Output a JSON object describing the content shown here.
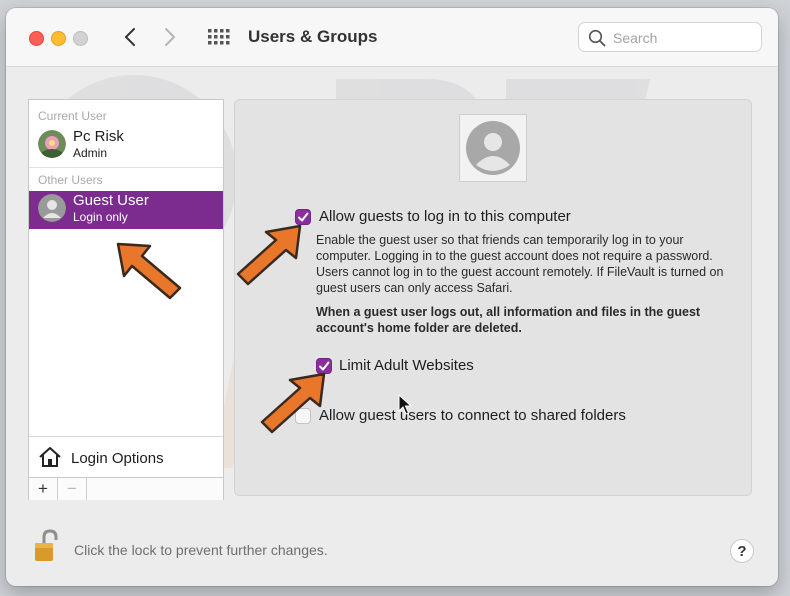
{
  "window": {
    "title": "Users & Groups",
    "search_placeholder": "Search"
  },
  "sidebar": {
    "current_user_label": "Current User",
    "current_user": {
      "name": "Pc Risk",
      "role": "Admin"
    },
    "other_users_label": "Other Users",
    "guest_user": {
      "name": "Guest User",
      "role": "Login only"
    },
    "login_options_label": "Login Options",
    "add_label": "+",
    "remove_label": "−"
  },
  "panel": {
    "allow_guests": {
      "label": "Allow guests to log in to this computer",
      "checked": true
    },
    "description": "Enable the guest user so that friends can temporarily log in to your computer. Logging in to the guest account does not require a password. Users cannot log in to the guest account remotely. If FileVault is turned on guest users can only access Safari.",
    "warning": "When a guest user logs out, all information and files in the guest account's home folder are deleted.",
    "limit_adult": {
      "label": "Limit Adult Websites",
      "checked": true
    },
    "shared_folders": {
      "label": "Allow guest users to connect to shared folders",
      "checked": false
    }
  },
  "footer": {
    "lock_text": "Click the lock to prevent further changes.",
    "help_label": "?"
  },
  "colors": {
    "accent": "#8a2e9b",
    "selected_row": "#7b2c8e",
    "arrow": "#e8762b"
  }
}
